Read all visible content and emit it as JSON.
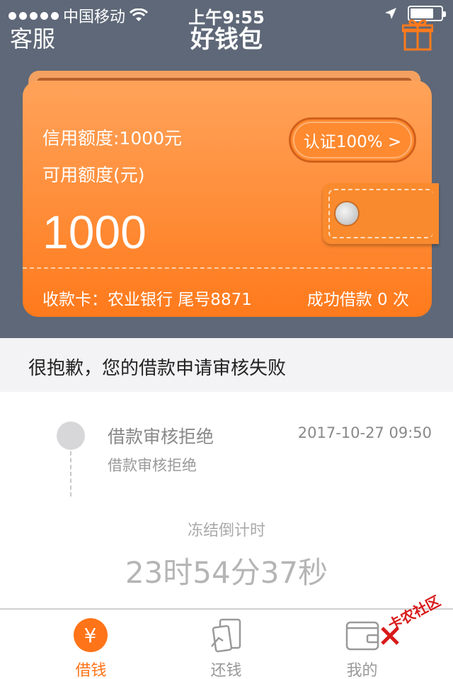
{
  "status_bar": {
    "carrier": "中国移动",
    "time": "上午9:55",
    "battery_level": 0.75,
    "icons": [
      "signal-dots-icon",
      "wifi-icon",
      "location-arrow-icon",
      "battery-icon"
    ]
  },
  "nav": {
    "service_label": "客服",
    "title": "好钱包",
    "gift_icon": "gift-icon"
  },
  "wallet": {
    "credit_line": "信用额度:1000元",
    "available_label": "可用额度(元)",
    "available_amount": "1000",
    "verify_button": "认证100% >",
    "card_info": "收款卡：农业银行 尾号8871",
    "success_count": "成功借款 0 次"
  },
  "notice": {
    "message": "很抱歉，您的借款申请审核失败"
  },
  "timeline": {
    "event_title": "借款审核拒绝",
    "event_subtitle": "借款审核拒绝",
    "event_time": "2017-10-27 09:50"
  },
  "countdown": {
    "label": "冻结倒计时",
    "value": "23时54分37秒"
  },
  "tabbar": {
    "tabs": [
      {
        "label": "借钱",
        "icon": "yen-icon",
        "active": true
      },
      {
        "label": "还钱",
        "icon": "repay-card-icon",
        "active": false
      },
      {
        "label": "我的",
        "icon": "wallet-icon",
        "active": false
      }
    ]
  },
  "watermark": {
    "text": "卡农社区"
  },
  "colors": {
    "header_bg": "#5e6878",
    "accent": "#ff7418",
    "wallet_top": "#ffa35a",
    "wallet_bottom": "#ff7a1c"
  }
}
